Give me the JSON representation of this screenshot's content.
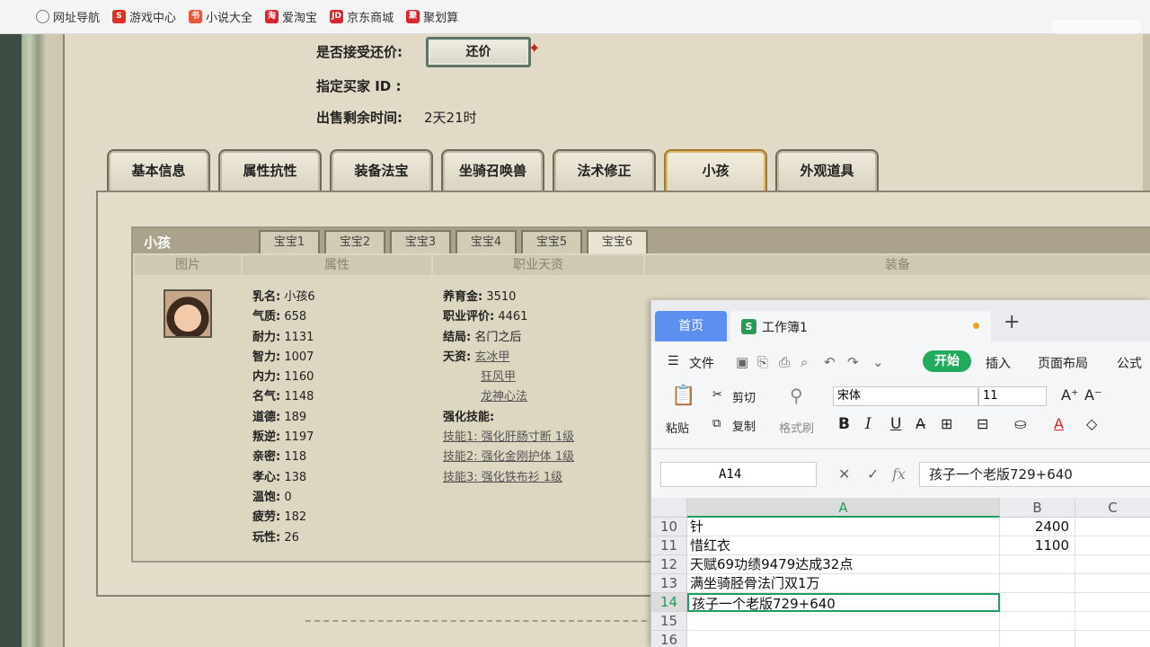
{
  "bookmarks": [
    {
      "label": "网址导航",
      "icon": "globe-icon",
      "color": "#777777",
      "glyph": ""
    },
    {
      "label": "游戏中心",
      "icon": "game-center-icon",
      "color": "#e0301e",
      "glyph": "S"
    },
    {
      "label": "小说大全",
      "icon": "novel-icon",
      "color": "#e8573a",
      "glyph": "书"
    },
    {
      "label": "爱淘宝",
      "icon": "taobao-icon",
      "color": "#d9262e",
      "glyph": "淘"
    },
    {
      "label": "京东商城",
      "icon": "jd-icon",
      "color": "#d9262e",
      "glyph": "JD"
    },
    {
      "label": "聚划算",
      "icon": "juhuasuan-icon",
      "color": "#d9262e",
      "glyph": "聚"
    }
  ],
  "listing": {
    "accept_haggle_label": "是否接受还价:",
    "haggle_button": "还价",
    "buyer_label": "指定买家 ID :",
    "time_label": "出售剩余时间:",
    "time_value": "2天21时"
  },
  "main_tabs": [
    {
      "label": "基本信息",
      "name": "tab-basic-info"
    },
    {
      "label": "属性抗性",
      "name": "tab-attributes"
    },
    {
      "label": "装备法宝",
      "name": "tab-equipment"
    },
    {
      "label": "坐骑召唤兽",
      "name": "tab-mounts-pets"
    },
    {
      "label": "法术修正",
      "name": "tab-spells"
    },
    {
      "label": "小孩",
      "name": "tab-children"
    },
    {
      "label": "外观道具",
      "name": "tab-appearance"
    }
  ],
  "child_panel": {
    "title": "小孩",
    "baby_tabs": [
      "宝宝1",
      "宝宝2",
      "宝宝3",
      "宝宝4",
      "宝宝5",
      "宝宝6"
    ],
    "columns": [
      "图片",
      "属性",
      "职业天资",
      "装备"
    ],
    "stats": [
      {
        "k": "乳名:",
        "v": "小孩6"
      },
      {
        "k": "气质:",
        "v": "658"
      },
      {
        "k": "耐力:",
        "v": "1131"
      },
      {
        "k": "智力:",
        "v": "1007"
      },
      {
        "k": "内力:",
        "v": "1160"
      },
      {
        "k": "名气:",
        "v": "1148"
      },
      {
        "k": "道德:",
        "v": "189"
      },
      {
        "k": "叛逆:",
        "v": "1197"
      },
      {
        "k": "亲密:",
        "v": "118"
      },
      {
        "k": "孝心:",
        "v": "138"
      },
      {
        "k": "温饱:",
        "v": "0"
      },
      {
        "k": "疲劳:",
        "v": "182"
      },
      {
        "k": "玩性:",
        "v": "26"
      }
    ],
    "career": {
      "money_k": "养育金:",
      "money_v": "3510",
      "rating_k": "职业评价:",
      "rating_v": "4461",
      "ending_k": "结局:",
      "ending_v": "名门之后",
      "talent_k": "天资:",
      "talents": [
        "玄冰甲",
        "狂风甲",
        "龙神心法"
      ],
      "skills_k": "强化技能:",
      "skills": [
        "技能1: 强化肝肠寸断 1级",
        "技能2: 强化金刚护体 1级",
        "技能3: 强化铁布衫 1级"
      ]
    }
  },
  "spreadsheet": {
    "home_tab": "首页",
    "workbook_icon": "S",
    "workbook_name": "工作簿1",
    "menu": {
      "file": "文件",
      "start": "开始",
      "insert": "插入",
      "layout": "页面布局",
      "formula": "公式"
    },
    "ribbon": {
      "cut": "剪切",
      "paste": "粘贴",
      "copy": "复制",
      "format_painter": "格式刷",
      "font": "宋体",
      "size": "11",
      "bold": "B",
      "italic": "I",
      "underline": "U"
    },
    "name_box": "A14",
    "fx": "fx",
    "formula": "孩子一个老版729+640",
    "columns": [
      "A",
      "B",
      "C"
    ],
    "rows": [
      {
        "n": "10",
        "a": "针",
        "b": "2400"
      },
      {
        "n": "11",
        "a": "惜红衣",
        "b": "1100"
      },
      {
        "n": "12",
        "a": "天赋69功绩9479达成32点",
        "b": ""
      },
      {
        "n": "13",
        "a": "满坐骑胫骨法门双1万",
        "b": ""
      },
      {
        "n": "14",
        "a": "孩子一个老版729+640",
        "b": ""
      },
      {
        "n": "15",
        "a": "",
        "b": ""
      },
      {
        "n": "16",
        "a": "",
        "b": ""
      }
    ]
  }
}
